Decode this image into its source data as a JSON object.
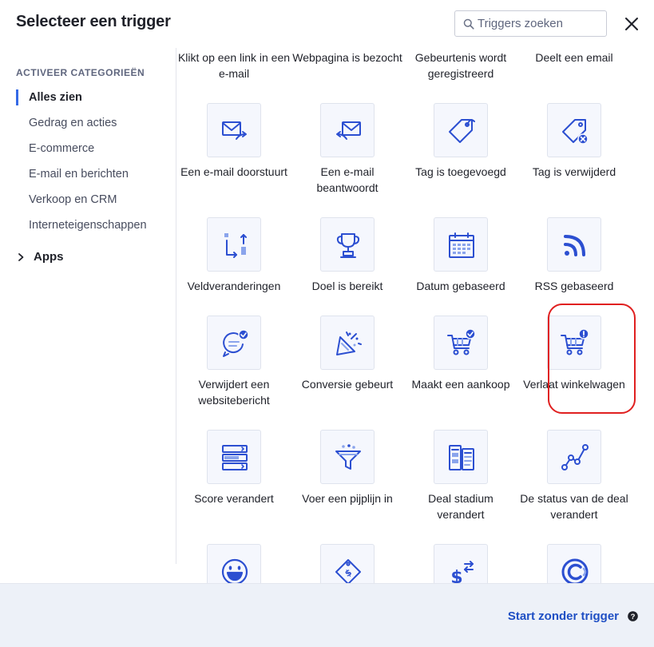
{
  "header": {
    "title": "Selecteer een trigger",
    "search_placeholder": "Triggers zoeken"
  },
  "sidebar": {
    "heading": "ACTIVEER CATEGORIEËN",
    "categories": [
      {
        "label": "Alles zien",
        "active": true
      },
      {
        "label": "Gedrag en acties",
        "active": false
      },
      {
        "label": "E-commerce",
        "active": false
      },
      {
        "label": "E-mail en berichten",
        "active": false
      },
      {
        "label": "Verkoop en CRM",
        "active": false
      },
      {
        "label": "Interneteigenschappen",
        "active": false
      }
    ],
    "apps_label": "Apps"
  },
  "tiles": [
    {
      "label": "Klikt op een link in een e-mail",
      "icon": "email-link-icon"
    },
    {
      "label": "Webpagina is bezocht",
      "icon": "webpage-icon"
    },
    {
      "label": "Gebeurtenis wordt geregistreerd",
      "icon": "event-icon"
    },
    {
      "label": "Deelt een email",
      "icon": "share-email-icon"
    },
    {
      "label": "Een e-mail doorstuurt",
      "icon": "forward-email-icon"
    },
    {
      "label": "Een e-mail beantwoordt",
      "icon": "reply-email-icon"
    },
    {
      "label": "Tag is toegevoegd",
      "icon": "tag-added-icon"
    },
    {
      "label": "Tag is verwijderd",
      "icon": "tag-removed-icon"
    },
    {
      "label": "Veldveranderingen",
      "icon": "field-change-icon"
    },
    {
      "label": "Doel is bereikt",
      "icon": "trophy-icon"
    },
    {
      "label": "Datum gebaseerd",
      "icon": "calendar-icon"
    },
    {
      "label": "RSS gebaseerd",
      "icon": "rss-icon"
    },
    {
      "label": "Verwijdert een websitebericht",
      "icon": "site-message-icon"
    },
    {
      "label": "Conversie gebeurt",
      "icon": "party-popper-icon"
    },
    {
      "label": "Maakt een aankoop",
      "icon": "cart-check-icon"
    },
    {
      "label": "Verlaat winkelwagen",
      "icon": "cart-alert-icon",
      "highlighted": true
    },
    {
      "label": "Score verandert",
      "icon": "score-icon"
    },
    {
      "label": "Voer een pijplijn in",
      "icon": "funnel-icon"
    },
    {
      "label": "Deal stadium verandert",
      "icon": "deal-stage-icon"
    },
    {
      "label": "De status van de deal verandert",
      "icon": "line-chart-icon"
    },
    {
      "label": "",
      "icon": "smiley-icon"
    },
    {
      "label": "",
      "icon": "price-tag-icon"
    },
    {
      "label": "",
      "icon": "currency-exchange-icon"
    },
    {
      "label": "",
      "icon": "calendly-icon"
    }
  ],
  "footer": {
    "start_label": "Start zonder trigger"
  },
  "colors": {
    "accent": "#356ae6",
    "icon_blue": "#2c4fd1",
    "highlight_red": "#e02020",
    "footer_bg": "#edf1f8"
  }
}
